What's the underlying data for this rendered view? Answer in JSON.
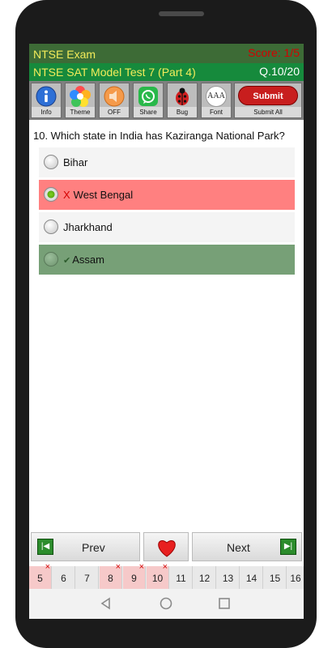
{
  "header": {
    "app_title": "NTSE Exam",
    "score": "Score: 1/5",
    "test_title": "NTSE SAT Model Test 7 (Part 4)",
    "question_counter": "Q.10/20"
  },
  "toolbar": {
    "items": [
      {
        "label": "Info",
        "icon": "info-icon"
      },
      {
        "label": "Theme",
        "icon": "flower-icon"
      },
      {
        "label": "OFF",
        "icon": "speaker-icon"
      },
      {
        "label": "Share",
        "icon": "whatsapp-icon"
      },
      {
        "label": "Bug",
        "icon": "ladybug-icon"
      },
      {
        "label": "Font",
        "icon": "font-icon"
      }
    ],
    "submit_label": "Submit",
    "submit_all_label": "Submit All",
    "font_icon_text": "AAA"
  },
  "question": {
    "text": "10. Which state in India has Kaziranga National Park?",
    "options": [
      {
        "text": "Bihar",
        "state": "unselected"
      },
      {
        "text": "West Bengal",
        "state": "selected-wrong",
        "mark": "X"
      },
      {
        "text": "Jharkhand",
        "state": "unselected"
      },
      {
        "text": "Assam",
        "state": "correct",
        "mark": "✔"
      }
    ]
  },
  "navigation": {
    "prev_label": "Prev",
    "next_label": "Next",
    "favorite_icon": "heart-icon"
  },
  "question_bar": {
    "items": [
      {
        "num": "5",
        "wrong": true
      },
      {
        "num": "6",
        "wrong": false
      },
      {
        "num": "7",
        "wrong": false
      },
      {
        "num": "8",
        "wrong": true
      },
      {
        "num": "9",
        "wrong": true
      },
      {
        "num": "10",
        "wrong": true
      },
      {
        "num": "11",
        "wrong": false
      },
      {
        "num": "12",
        "wrong": false
      },
      {
        "num": "13",
        "wrong": false
      },
      {
        "num": "14",
        "wrong": false
      },
      {
        "num": "15",
        "wrong": false
      },
      {
        "num": "16",
        "wrong": false
      }
    ],
    "wrong_mark": "×"
  },
  "colors": {
    "header_bg": "#3d6b36",
    "subheader_bg": "#168a3c",
    "title_text": "#f3ec5a",
    "score_text": "#d40000",
    "wrong_option_bg": "#ff8080",
    "correct_option_bg": "#77a077",
    "submit_bg": "#c81e1e"
  }
}
